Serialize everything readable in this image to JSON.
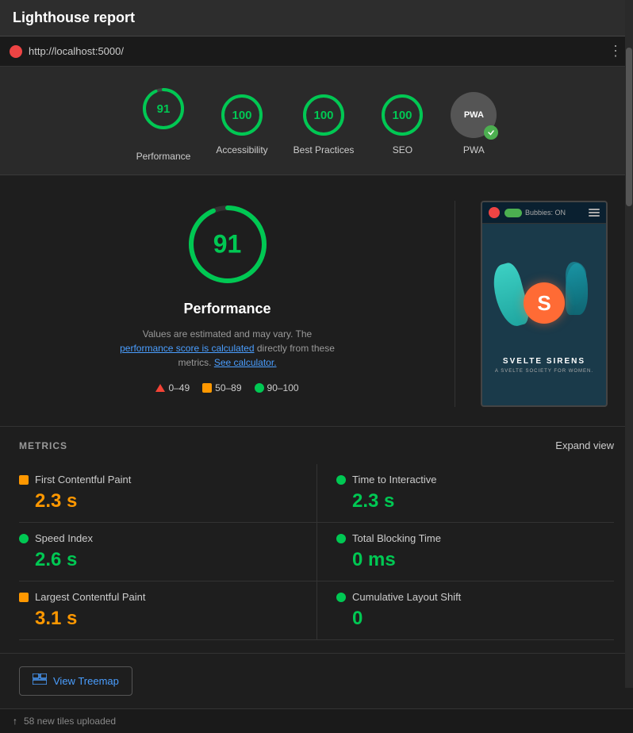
{
  "titleBar": {
    "title": "Lighthouse report"
  },
  "urlBar": {
    "address": "http://localhost:5000/",
    "menuIcon": "⋮"
  },
  "scores": [
    {
      "id": "performance",
      "value": 91,
      "label": "Performance",
      "color": "#00c853",
      "arc": 329
    },
    {
      "id": "accessibility",
      "value": 100,
      "label": "Accessibility",
      "color": "#00c853",
      "arc": 360
    },
    {
      "id": "best-practices",
      "value": 100,
      "label": "Best Practices",
      "color": "#00c853",
      "arc": 360
    },
    {
      "id": "seo",
      "value": 100,
      "label": "SEO",
      "color": "#00c853",
      "arc": 360
    },
    {
      "id": "pwa",
      "value": "PWA",
      "label": "PWA",
      "isPwa": true
    }
  ],
  "performancePanel": {
    "score": 91,
    "title": "Performance",
    "description": "Values are estimated and may vary. The",
    "linkText": "performance score is calculated",
    "descriptionEnd": "directly from these metrics.",
    "calculatorLink": "See calculator.",
    "legend": [
      {
        "type": "triangle",
        "range": "0–49"
      },
      {
        "type": "square",
        "range": "50–89"
      },
      {
        "type": "dot",
        "range": "90–100"
      }
    ]
  },
  "screenshot": {
    "toggleLabel": "Bubbies: ON",
    "appName": "SVELTE SIRENS",
    "appTagline": "A SVELTE SOCIETY FOR WOMEN."
  },
  "metrics": {
    "sectionTitle": "METRICS",
    "expandLabel": "Expand view",
    "items": [
      {
        "id": "fcp",
        "name": "First Contentful Paint",
        "value": "2.3 s",
        "color": "orange",
        "dotShape": "square"
      },
      {
        "id": "tti",
        "name": "Time to Interactive",
        "value": "2.3 s",
        "color": "green",
        "dotShape": "circle"
      },
      {
        "id": "si",
        "name": "Speed Index",
        "value": "2.6 s",
        "color": "green",
        "dotShape": "circle"
      },
      {
        "id": "tbt",
        "name": "Total Blocking Time",
        "value": "0 ms",
        "color": "green",
        "dotShape": "circle"
      },
      {
        "id": "lcp",
        "name": "Largest Contentful Paint",
        "value": "3.1 s",
        "color": "orange",
        "dotShape": "square"
      },
      {
        "id": "cls",
        "name": "Cumulative Layout Shift",
        "value": "0",
        "color": "green",
        "dotShape": "circle"
      }
    ]
  },
  "treemap": {
    "buttonLabel": "View Treemap",
    "icon": "⊞"
  },
  "bottomBar": {
    "icon": "↑",
    "text": "58 new tiles uploaded"
  }
}
